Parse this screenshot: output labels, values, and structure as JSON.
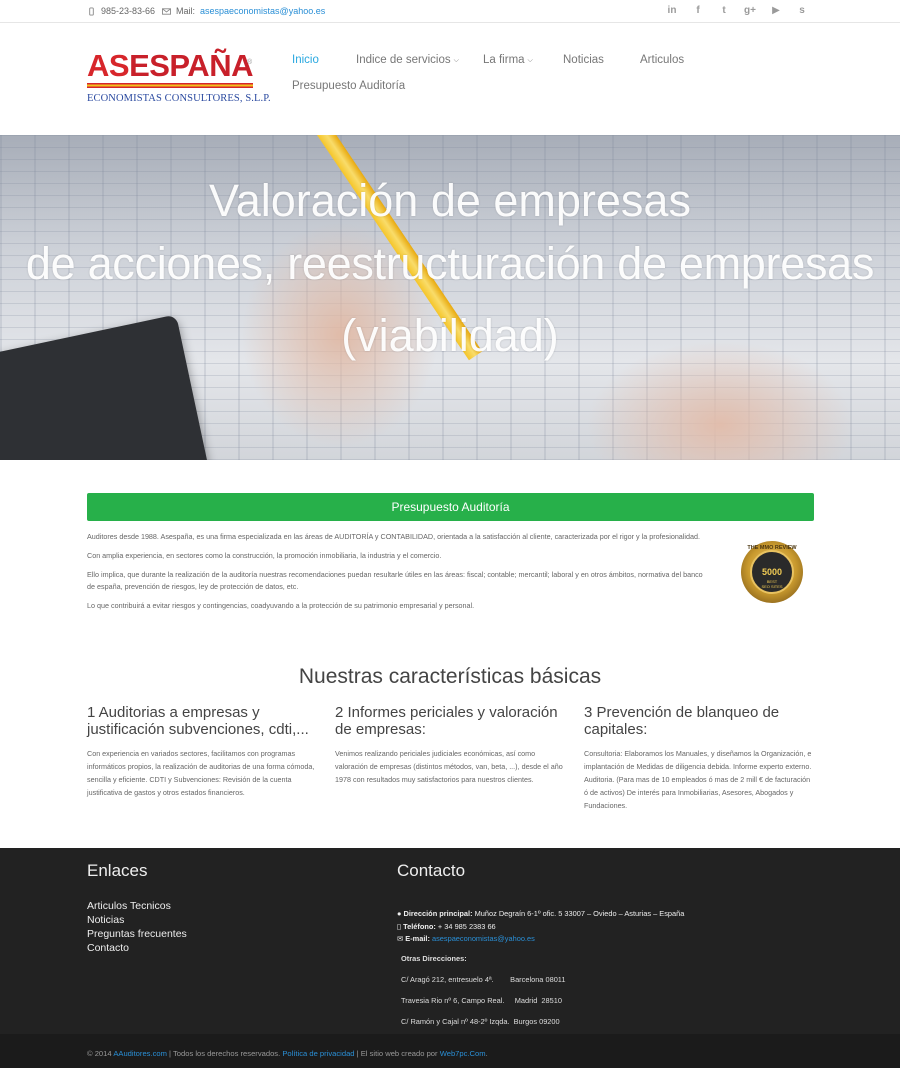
{
  "topbar": {
    "phone": "985-23-83-66",
    "mail_label": "Mail:",
    "mail_value": "asespaeconomistas@yahoo.es",
    "social": [
      {
        "icon": "linkedin-icon",
        "glyph": "in"
      },
      {
        "icon": "facebook-icon",
        "glyph": "f"
      },
      {
        "icon": "twitter-icon",
        "glyph": "t"
      },
      {
        "icon": "googleplus-icon",
        "glyph": "g+"
      },
      {
        "icon": "youtube-icon",
        "glyph": "▶"
      },
      {
        "icon": "skype-icon",
        "glyph": "s"
      }
    ]
  },
  "logo": {
    "brand_as": "AS",
    "brand_espana": "ESPAÑA",
    "registered": "®",
    "subtitle": "ECONOMISTAS CONSULTORES, S.L.P."
  },
  "nav": {
    "inicio": "Inicio",
    "indice": "Indice de servicios",
    "firma": "La firma",
    "noticias": "Noticias",
    "articulos": "Articulos",
    "presupuesto": "Presupuesto Auditoría",
    "active_color": "#29a8e0"
  },
  "hero": {
    "line1": "Valoración de empresas",
    "line2": "de acciones, reestructuración de empresas",
    "line3": "(viabilidad)"
  },
  "cta": {
    "label": "Presupuesto Auditoría",
    "color": "#27b04a"
  },
  "intro": {
    "p1": "Auditores desde 1988. Asespaña, es una firma especializada en las áreas de AUDITORÍA y CONTABILIDAD, orientada a la satisfacción al cliente, caracterizada por el rigor y la profesionalidad.",
    "p2": "Con amplia experiencia, en sectores como la construcción, la promoción inmobiliaria, la industria y el comercio.",
    "p3": "Ello implica, que durante la realización de la auditoría nuestras recomendaciones puedan resultarle útiles en las áreas: fiscal; contable; mercantil;  laboral y en otros ámbitos, normativa del banco de españa, prevención de riesgos, ley de protección de datos, etc.",
    "p4": "Lo que contribuirá a evitar riesgos y contingencias, coadyuvando a la protección de su patrimonio empresarial y personal."
  },
  "seal": {
    "top": "THE MMO REVIEW",
    "number": "5000",
    "bottom1": "BEST",
    "bottom2": "SEO SITES"
  },
  "features": {
    "title": "Nuestras características básicas",
    "items": [
      {
        "title": "1 Auditorias a empresas y justificación subvenciones, cdti,...",
        "text": "Con experiencia en variados sectores, facilitamos con programas informáticos propios, la realización de auditorias de una forma cómoda, sencilla y eficiente. CDTI y Subvenciones: Revisión de la cuenta justificativa de gastos y otros estados financieros."
      },
      {
        "title": "2 Informes periciales y valoración de empresas:",
        "text": "Venimos realizando periciales judiciales económicas, así como valoración de empresas (distintos métodos, van, beta, ...), desde el año 1978 con resultados muy satisfactorios para nuestros clientes."
      },
      {
        "title": "3 Prevención de blanqueo de capitales:",
        "text": "Consultoria: Elaboramos los Manuales, y diseñamos la Organización, e implantación de Medidas de diligencia debida. Informe experto externo. Auditoria. (Para mas de 10 empleados ó mas de 2 mill € de facturación ó de activos) De interés para Inmobiliarias, Asesores, Abogados y Fundaciones."
      }
    ]
  },
  "footer": {
    "links_title": "Enlaces",
    "links": [
      "Articulos Tecnicos",
      "Noticias",
      "Preguntas frecuentes",
      "Contacto"
    ],
    "contact_title": "Contacto",
    "address_label": "Dirección principal:",
    "address_value": "Muñoz Degraín 6-1º ofic. 5 33007 – Oviedo – Asturias – España",
    "phone_label": "Teléfono:",
    "phone_value": "+ 34 985 2383 66",
    "email_label": "E-mail:",
    "email_value": "asespaeconomistas@yahoo.es",
    "other_title": "Otras Direcciones:",
    "other": [
      "C/ Aragó 212, entresuelo 4ª.        Barcelona 08011",
      "Travesia Rio nº 6, Campo Real.     Madrid  28510",
      "C/ Ramón y Cajal nº 48-2º Izqda.  Burgos 09200"
    ]
  },
  "bottom": {
    "copy": "© 2014",
    "site_link": "AAuditores.com",
    "rights": "| Todos los derechos reservados.",
    "privacy": "Política de privacidad",
    "made_by": "| El sitio web creado por",
    "maker": "Web7pc.Com",
    "end": "."
  }
}
